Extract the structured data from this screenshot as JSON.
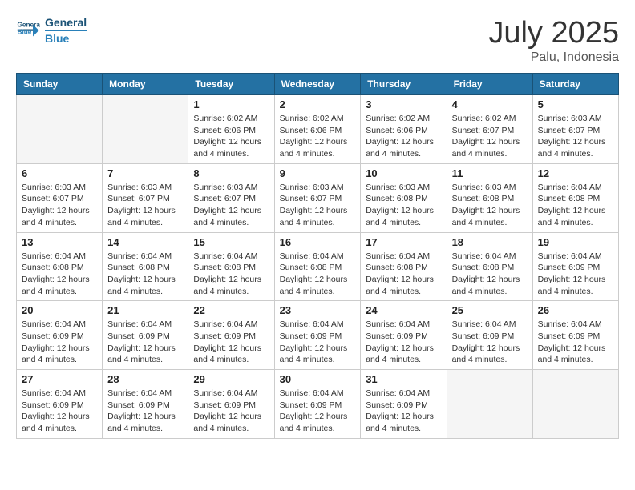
{
  "header": {
    "logo_line1": "General",
    "logo_line2": "Blue",
    "month": "July 2025",
    "location": "Palu, Indonesia"
  },
  "weekdays": [
    "Sunday",
    "Monday",
    "Tuesday",
    "Wednesday",
    "Thursday",
    "Friday",
    "Saturday"
  ],
  "weeks": [
    [
      {
        "day": "",
        "info": ""
      },
      {
        "day": "",
        "info": ""
      },
      {
        "day": "1",
        "info": "Sunrise: 6:02 AM\nSunset: 6:06 PM\nDaylight: 12 hours and 4 minutes."
      },
      {
        "day": "2",
        "info": "Sunrise: 6:02 AM\nSunset: 6:06 PM\nDaylight: 12 hours and 4 minutes."
      },
      {
        "day": "3",
        "info": "Sunrise: 6:02 AM\nSunset: 6:06 PM\nDaylight: 12 hours and 4 minutes."
      },
      {
        "day": "4",
        "info": "Sunrise: 6:02 AM\nSunset: 6:07 PM\nDaylight: 12 hours and 4 minutes."
      },
      {
        "day": "5",
        "info": "Sunrise: 6:03 AM\nSunset: 6:07 PM\nDaylight: 12 hours and 4 minutes."
      }
    ],
    [
      {
        "day": "6",
        "info": "Sunrise: 6:03 AM\nSunset: 6:07 PM\nDaylight: 12 hours and 4 minutes."
      },
      {
        "day": "7",
        "info": "Sunrise: 6:03 AM\nSunset: 6:07 PM\nDaylight: 12 hours and 4 minutes."
      },
      {
        "day": "8",
        "info": "Sunrise: 6:03 AM\nSunset: 6:07 PM\nDaylight: 12 hours and 4 minutes."
      },
      {
        "day": "9",
        "info": "Sunrise: 6:03 AM\nSunset: 6:07 PM\nDaylight: 12 hours and 4 minutes."
      },
      {
        "day": "10",
        "info": "Sunrise: 6:03 AM\nSunset: 6:08 PM\nDaylight: 12 hours and 4 minutes."
      },
      {
        "day": "11",
        "info": "Sunrise: 6:03 AM\nSunset: 6:08 PM\nDaylight: 12 hours and 4 minutes."
      },
      {
        "day": "12",
        "info": "Sunrise: 6:04 AM\nSunset: 6:08 PM\nDaylight: 12 hours and 4 minutes."
      }
    ],
    [
      {
        "day": "13",
        "info": "Sunrise: 6:04 AM\nSunset: 6:08 PM\nDaylight: 12 hours and 4 minutes."
      },
      {
        "day": "14",
        "info": "Sunrise: 6:04 AM\nSunset: 6:08 PM\nDaylight: 12 hours and 4 minutes."
      },
      {
        "day": "15",
        "info": "Sunrise: 6:04 AM\nSunset: 6:08 PM\nDaylight: 12 hours and 4 minutes."
      },
      {
        "day": "16",
        "info": "Sunrise: 6:04 AM\nSunset: 6:08 PM\nDaylight: 12 hours and 4 minutes."
      },
      {
        "day": "17",
        "info": "Sunrise: 6:04 AM\nSunset: 6:08 PM\nDaylight: 12 hours and 4 minutes."
      },
      {
        "day": "18",
        "info": "Sunrise: 6:04 AM\nSunset: 6:08 PM\nDaylight: 12 hours and 4 minutes."
      },
      {
        "day": "19",
        "info": "Sunrise: 6:04 AM\nSunset: 6:09 PM\nDaylight: 12 hours and 4 minutes."
      }
    ],
    [
      {
        "day": "20",
        "info": "Sunrise: 6:04 AM\nSunset: 6:09 PM\nDaylight: 12 hours and 4 minutes."
      },
      {
        "day": "21",
        "info": "Sunrise: 6:04 AM\nSunset: 6:09 PM\nDaylight: 12 hours and 4 minutes."
      },
      {
        "day": "22",
        "info": "Sunrise: 6:04 AM\nSunset: 6:09 PM\nDaylight: 12 hours and 4 minutes."
      },
      {
        "day": "23",
        "info": "Sunrise: 6:04 AM\nSunset: 6:09 PM\nDaylight: 12 hours and 4 minutes."
      },
      {
        "day": "24",
        "info": "Sunrise: 6:04 AM\nSunset: 6:09 PM\nDaylight: 12 hours and 4 minutes."
      },
      {
        "day": "25",
        "info": "Sunrise: 6:04 AM\nSunset: 6:09 PM\nDaylight: 12 hours and 4 minutes."
      },
      {
        "day": "26",
        "info": "Sunrise: 6:04 AM\nSunset: 6:09 PM\nDaylight: 12 hours and 4 minutes."
      }
    ],
    [
      {
        "day": "27",
        "info": "Sunrise: 6:04 AM\nSunset: 6:09 PM\nDaylight: 12 hours and 4 minutes."
      },
      {
        "day": "28",
        "info": "Sunrise: 6:04 AM\nSunset: 6:09 PM\nDaylight: 12 hours and 4 minutes."
      },
      {
        "day": "29",
        "info": "Sunrise: 6:04 AM\nSunset: 6:09 PM\nDaylight: 12 hours and 4 minutes."
      },
      {
        "day": "30",
        "info": "Sunrise: 6:04 AM\nSunset: 6:09 PM\nDaylight: 12 hours and 4 minutes."
      },
      {
        "day": "31",
        "info": "Sunrise: 6:04 AM\nSunset: 6:09 PM\nDaylight: 12 hours and 4 minutes."
      },
      {
        "day": "",
        "info": ""
      },
      {
        "day": "",
        "info": ""
      }
    ]
  ]
}
